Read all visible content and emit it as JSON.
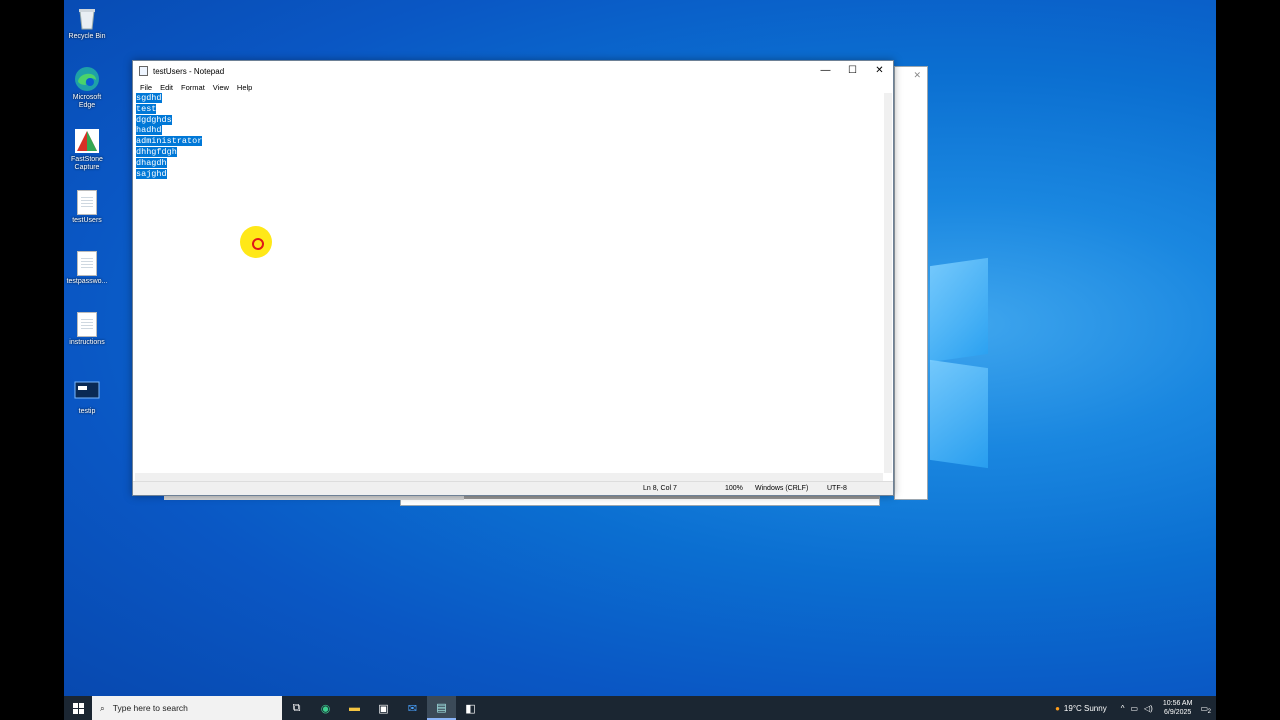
{
  "desktop": {
    "icons": [
      {
        "label": "Recycle Bin"
      },
      {
        "label": "Microsoft Edge"
      },
      {
        "label": "FastStone Capture"
      },
      {
        "label": "testUsers"
      },
      {
        "label": "testpasswo..."
      },
      {
        "label": "instructions"
      },
      {
        "label": "testip"
      }
    ]
  },
  "notepad": {
    "title": "testUsers - Notepad",
    "menu": [
      "File",
      "Edit",
      "Format",
      "View",
      "Help"
    ],
    "lines": [
      "sgdhd",
      "test",
      "dgdghds",
      "hadhd",
      "administrator",
      "dhhgfdgh",
      "dhagdh",
      "sajghd"
    ],
    "controls": {
      "minimize": "—",
      "maximize": "☐",
      "close": "✕"
    },
    "status": {
      "position": "Ln 8, Col 7",
      "zoom": "100%",
      "line_ending": "Windows (CRLF)",
      "encoding": "UTF-8"
    }
  },
  "taskbar": {
    "search_placeholder": "Type here to search",
    "weather": "19°C  Sunny",
    "time": "10:56 AM",
    "date": "6/9/2025",
    "notification_count": "2"
  }
}
